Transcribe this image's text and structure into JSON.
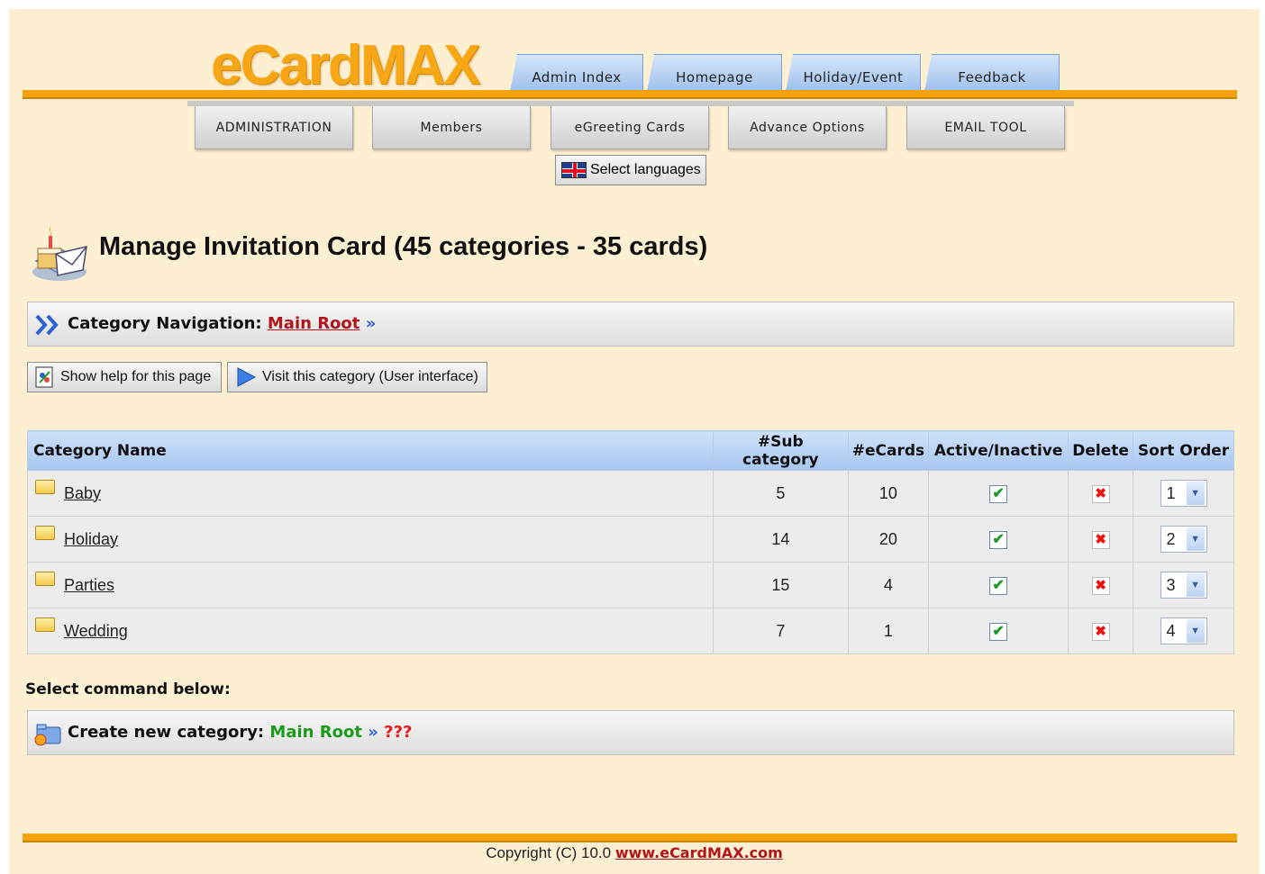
{
  "header": {
    "logo_text": "eCardMAX",
    "tabs": [
      {
        "label": "Admin Index"
      },
      {
        "label": "Homepage"
      },
      {
        "label": "Holiday/Event"
      },
      {
        "label": "Feedback"
      }
    ],
    "subnav": [
      {
        "label": "ADMINISTRATION"
      },
      {
        "label": "Members"
      },
      {
        "label": "eGreeting Cards"
      },
      {
        "label": "Advance Options"
      },
      {
        "label": "EMAIL TOOL"
      }
    ],
    "language_button": "Select languages"
  },
  "page": {
    "title": "Manage Invitation Card (45 categories - 35 cards)"
  },
  "navigation": {
    "label": "Category Navigation:",
    "root_link": "Main Root",
    "separator": "»"
  },
  "actions": {
    "help_button": "Show help for this page",
    "visit_button": "Visit this category (User interface)"
  },
  "table": {
    "headers": [
      "Category Name",
      "#Sub category",
      "#eCards",
      "Active/Inactive",
      "Delete",
      "Sort Order"
    ],
    "rows": [
      {
        "name": "Baby",
        "sub": "5",
        "ecards": "10",
        "active": "✔",
        "delete": "✖",
        "sort": "1"
      },
      {
        "name": "Holiday",
        "sub": "14",
        "ecards": "20",
        "active": "✔",
        "delete": "✖",
        "sort": "2"
      },
      {
        "name": "Parties",
        "sub": "15",
        "ecards": "4",
        "active": "✔",
        "delete": "✖",
        "sort": "3"
      },
      {
        "name": "Wedding",
        "sub": "7",
        "ecards": "1",
        "active": "✔",
        "delete": "✖",
        "sort": "4"
      }
    ]
  },
  "commands": {
    "heading": "Select command below:",
    "create_label": "Create new category:",
    "create_root": "Main Root",
    "create_separator": "»",
    "create_placeholder": "???"
  },
  "footer": {
    "copyright": "Copyright (C) 10.0",
    "link": "www.eCardMAX.com"
  },
  "colors": {
    "background": "#fdf0d2",
    "orange_bar": "#f4a20e",
    "tab_blue": "#a7c6f0",
    "link_red": "#b3141c",
    "green": "#1b9b1b"
  }
}
